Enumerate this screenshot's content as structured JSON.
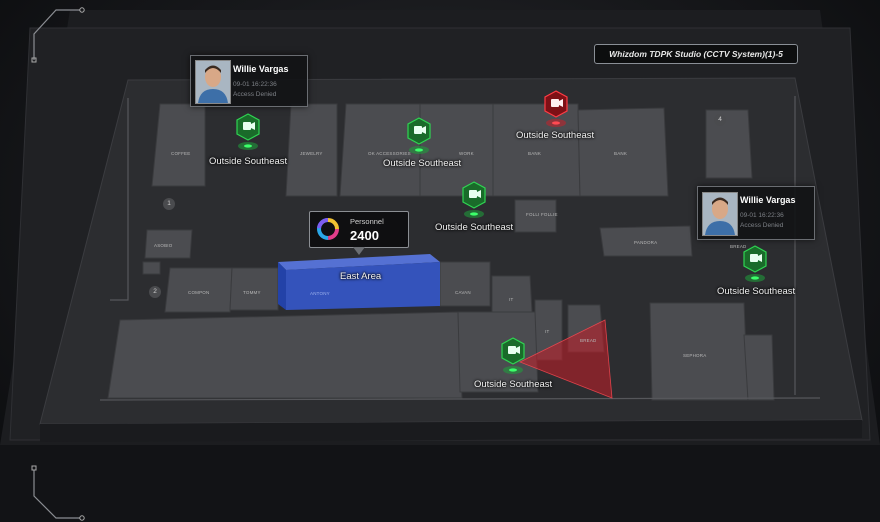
{
  "header": {
    "title": "Whizdom TDPK Studio (CCTV System)(1)-5"
  },
  "colors": {
    "accent_green": "#1fa33c",
    "alert_red": "#c8202a",
    "area_blue": "#2f4fb8",
    "panel_bg": "#141518"
  },
  "cameras": [
    {
      "label": "Outside Southeast",
      "status": "normal",
      "icon": "cctv-camera-icon"
    },
    {
      "label": "Outside Southeast",
      "status": "normal",
      "icon": "cctv-camera-icon"
    },
    {
      "label": "Outside Southeast",
      "status": "alarm",
      "icon": "cctv-camera-icon"
    },
    {
      "label": "Outside Southeast",
      "status": "normal",
      "icon": "cctv-camera-icon"
    },
    {
      "label": "Outside Southeast",
      "status": "normal",
      "icon": "cctv-camera-icon"
    },
    {
      "label": "Outside Southeast",
      "status": "normal",
      "icon": "cctv-camera-icon"
    }
  ],
  "access_events": [
    {
      "name": "Willie Vargas",
      "time": "09-01 16:22:36",
      "status": "Access Denied"
    },
    {
      "name": "Willie Vargas",
      "time": "09-01 16:22:36",
      "status": "Access Denied"
    }
  ],
  "personnel": {
    "label": "Personnel",
    "value": "2400",
    "icon": "donut-chart-icon"
  },
  "area": {
    "label": "East Area",
    "sub": "ANTONY"
  },
  "floor_numbers": [
    "1",
    "2",
    "4"
  ],
  "shops": {
    "coffee": "COFFEE",
    "jewelry": "JEWELRY",
    "ok_accessories": "OK ACCESSORIES",
    "work": "WORK",
    "bank1": "BANK",
    "bank2": "BANK",
    "folli": "FOLLI FOLLIE",
    "pandora": "PANDORA",
    "asobio": "ASOBIO",
    "compon": "COMPON",
    "tommy": "TOMMY",
    "cavan": "CAVAN",
    "it": "IT",
    "it2": "IT",
    "bread": "BREAD",
    "bread2": "BREAD",
    "sephora": "SEPHORA"
  }
}
